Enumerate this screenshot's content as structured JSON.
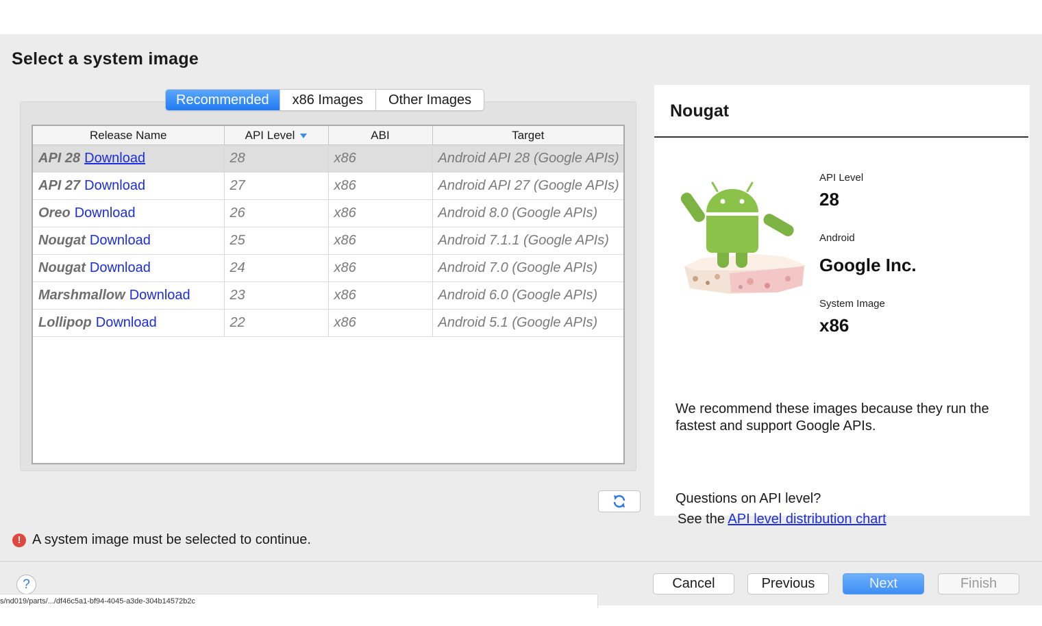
{
  "page": {
    "title": "Select a system image"
  },
  "tabs": [
    {
      "label": "Recommended",
      "active": true
    },
    {
      "label": "x86 Images",
      "active": false
    },
    {
      "label": "Other Images",
      "active": false
    }
  ],
  "table": {
    "columns": [
      "Release Name",
      "API Level",
      "ABI",
      "Target"
    ],
    "sort_column": "API Level",
    "rows": [
      {
        "release": "API 28",
        "link": "Download",
        "api": "28",
        "abi": "x86",
        "target": "Android API 28 (Google APIs)",
        "selected": true
      },
      {
        "release": "API 27",
        "link": "Download",
        "api": "27",
        "abi": "x86",
        "target": "Android API 27 (Google APIs)",
        "selected": false
      },
      {
        "release": "Oreo",
        "link": "Download",
        "api": "26",
        "abi": "x86",
        "target": "Android 8.0 (Google APIs)",
        "selected": false
      },
      {
        "release": "Nougat",
        "link": "Download",
        "api": "25",
        "abi": "x86",
        "target": "Android 7.1.1 (Google APIs)",
        "selected": false
      },
      {
        "release": "Nougat",
        "link": "Download",
        "api": "24",
        "abi": "x86",
        "target": "Android 7.0 (Google APIs)",
        "selected": false
      },
      {
        "release": "Marshmallow",
        "link": "Download",
        "api": "23",
        "abi": "x86",
        "target": "Android 6.0 (Google APIs)",
        "selected": false
      },
      {
        "release": "Lollipop",
        "link": "Download",
        "api": "22",
        "abi": "x86",
        "target": "Android 5.1 (Google APIs)",
        "selected": false
      }
    ]
  },
  "refresh_icon": "refresh-icon",
  "detail": {
    "title": "Nougat",
    "api_level_label": "API Level",
    "api_level_value": "28",
    "android_label": "Android",
    "android_value": "Google Inc.",
    "system_image_label": "System Image",
    "system_image_value": "x86",
    "description": "We recommend these images because they run the fastest and support Google APIs.",
    "question": "Questions on API level?",
    "see_prefix": "See the ",
    "see_link": "API level distribution chart"
  },
  "error": {
    "icon": "error-icon",
    "message": "A system image must be selected to continue."
  },
  "footer": {
    "help_label": "?",
    "cancel": "Cancel",
    "previous": "Previous",
    "next": "Next",
    "finish": "Finish"
  },
  "status_bar": {
    "url": "s/nd019/parts/.../df46c5a1-bf94-4045-a3de-304b14572b2c"
  },
  "colors": {
    "accent": "#1f7af3",
    "link": "#1a2de0",
    "error": "#e0473f"
  }
}
